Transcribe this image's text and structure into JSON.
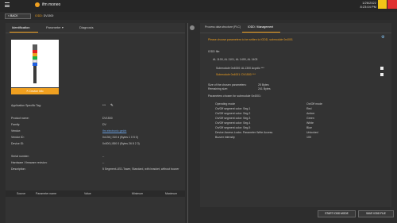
{
  "header": {
    "brand": "ifm moneo",
    "date": "1/26/2022",
    "time": "8:23:04 PM"
  },
  "nav": {
    "back_label": "< BACK",
    "breadcrumb_prefix": "IODD: ",
    "breadcrumb_device": "DV1500"
  },
  "left_tabs": {
    "identification": "Identification",
    "parameter": "Parameter",
    "diagnosis": "Diagnosis"
  },
  "device_button": "Device info",
  "identification": {
    "app_tag_label": "Application Specific Tag:",
    "app_tag_value": "***",
    "product_name_label": "Product name:",
    "product_name_value": "DV1500",
    "family_label": "Family:",
    "family_value": "DV",
    "vendor_label": "Vendor:",
    "vendor_value": "ifm electronic gmbh",
    "vendor_id_label": "Vendor ID:",
    "vendor_id_value": "0x136 | 310 d (Bytes 1 0 5 0)",
    "device_id_label": "Device ID:",
    "device_id_value": "0x000 | 850 0 (Bytes 26 8 2 3)",
    "serial_label": "Serial number:",
    "serial_value": "--",
    "hw_label": "Hardware / firmware revision:",
    "hw_value": "--",
    "desc_label": "Description:",
    "desc_value": "5 Segment-LED-Tower, Standard, with bracket, without buzzer"
  },
  "param_table": {
    "headers": [
      "Source",
      "Parameter name",
      "Value",
      "Minimum",
      "Maximum"
    ]
  },
  "right_tabs": {
    "process_info": "Process data structure (PLC)",
    "iodd_mgmt": "IODD / Management"
  },
  "right": {
    "warning": "Please choose parameters to be written to IODD, submodule 0x4001",
    "iodd_file_label": "IODD file:",
    "iodd_file_value": "AL 1100, AL 1101, AL 1400, AL 1403",
    "submodule_1": "Submodule 0x4000: AL1300 Acyclic ***",
    "submodule_2": "Submodule 0x4001: DV1500 ***",
    "size_label": "Size of the chosen parameters:",
    "size_value": "25 Bytes",
    "remaining_label": "Remaining size:",
    "remaining_value": "241 Bytes",
    "params_title": "Parameters chosen for submodule 0x4001:",
    "params": [
      {
        "name": "Operating mode",
        "value": "On/Off mode"
      },
      {
        "name": "On/Off segment color: Seg.1",
        "value": "Red"
      },
      {
        "name": "On/Off segment color: Seg.2",
        "value": "Amber"
      },
      {
        "name": "On/Off segment color: Seg.3",
        "value": "Green"
      },
      {
        "name": "On/Off segment color: Seg.4",
        "value": "White"
      },
      {
        "name": "On/Off segment color: Seg.5",
        "value": "Blue"
      },
      {
        "name": "Device Access Locks. Parameter Write Access",
        "value": "Unlocked"
      },
      {
        "name": "Buzzer intensity",
        "value": "100"
      }
    ]
  },
  "buttons": {
    "start": "START IODD MODE",
    "save": "SAVE IODD FILE"
  }
}
